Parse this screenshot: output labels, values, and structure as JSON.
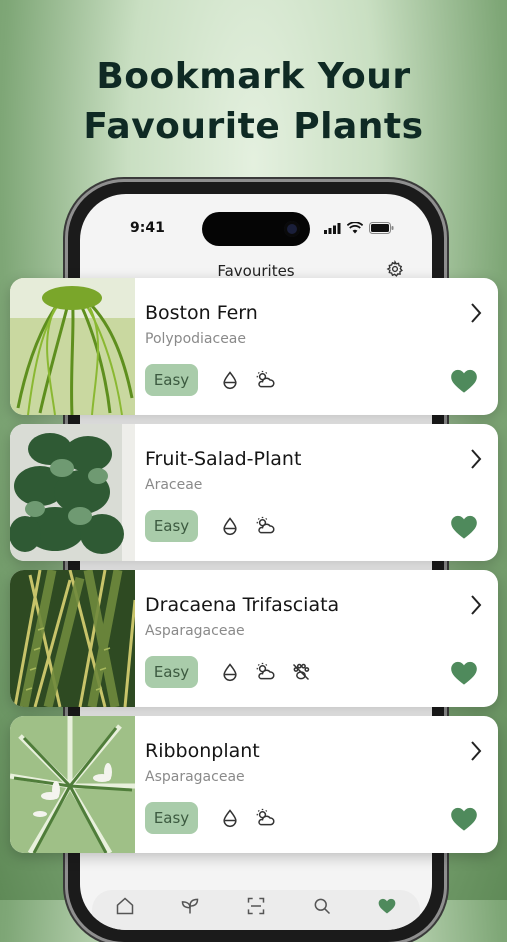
{
  "headline": {
    "line1": "Bookmark Your",
    "line2": "Favourite Plants"
  },
  "status_bar": {
    "time": "9:41"
  },
  "screen": {
    "title": "Favourites"
  },
  "plants": [
    {
      "name": "Boston Fern",
      "family": "Polypodiaceae",
      "difficulty": "Easy",
      "care_icons": [
        "water-drop-icon",
        "sun-cloud-icon"
      ]
    },
    {
      "name": "Fruit-Salad-Plant",
      "family": "Araceae",
      "difficulty": "Easy",
      "care_icons": [
        "water-drop-icon",
        "sun-cloud-icon"
      ]
    },
    {
      "name": "Dracaena Trifasciata",
      "family": "Asparagaceae",
      "difficulty": "Easy",
      "care_icons": [
        "water-drop-icon",
        "sun-cloud-icon",
        "no-pets-icon"
      ]
    },
    {
      "name": "Ribbonplant",
      "family": "Asparagaceae",
      "difficulty": "Easy",
      "care_icons": [
        "water-drop-icon",
        "sun-cloud-icon"
      ]
    }
  ],
  "tabbar": {
    "items": [
      "home-icon",
      "plant-icon",
      "scan-icon",
      "search-icon",
      "heart-icon"
    ],
    "active": "heart-icon"
  },
  "colors": {
    "accent": "#4f8a5c",
    "pill_bg": "#a9ccaa",
    "headline": "#0f2a24"
  }
}
